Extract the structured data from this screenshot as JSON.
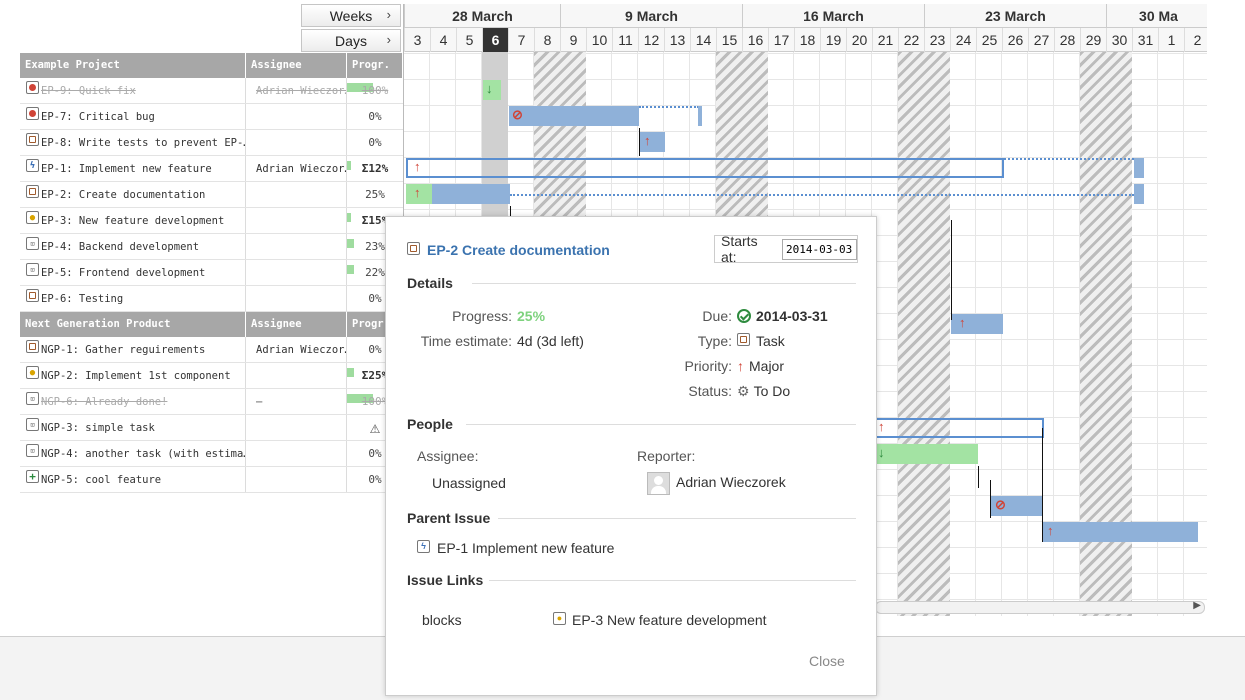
{
  "zoom": {
    "weeks_label": "Weeks",
    "days_label": "Days"
  },
  "table": {
    "groups": [
      {
        "headers": [
          "Example Project",
          "Assignee",
          "Progr."
        ],
        "rows": [
          {
            "key": "EP-9",
            "text": "EP-9: Quick fix",
            "icon": "bug-icon",
            "assignee": "Adrian Wieczor…",
            "progress": "100%",
            "done": true
          },
          {
            "key": "EP-7",
            "text": "EP-7: Critical bug",
            "icon": "bug-icon",
            "assignee": "",
            "progress": "0%"
          },
          {
            "key": "EP-8",
            "text": "EP-8: Write tests to prevent EP-…",
            "icon": "task-icon",
            "assignee": "",
            "progress": "0%"
          },
          {
            "key": "EP-1",
            "text": "EP-1: Implement new feature",
            "icon": "epic-icon",
            "assignee": "Adrian Wieczor…",
            "progress": "Σ12%"
          },
          {
            "key": "EP-2",
            "text": "EP-2: Create documentation",
            "icon": "task-icon",
            "assignee": "",
            "progress": "25%"
          },
          {
            "key": "EP-3",
            "text": "EP-3: New feature development",
            "icon": "story-icon",
            "assignee": "",
            "progress": "Σ15%"
          },
          {
            "key": "EP-4",
            "text": "EP-4: Backend development",
            "icon": "subtask-icon",
            "assignee": "",
            "progress": "23%"
          },
          {
            "key": "EP-5",
            "text": "EP-5: Frontend development",
            "icon": "subtask-icon",
            "assignee": "",
            "progress": "22%"
          },
          {
            "key": "EP-6",
            "text": "EP-6: Testing",
            "icon": "task-icon",
            "assignee": "",
            "progress": "0%"
          }
        ]
      },
      {
        "headers": [
          "Next Generation Product",
          "Assignee",
          "Progr."
        ],
        "rows": [
          {
            "key": "NGP-1",
            "text": "NGP-1: Gather reguirements",
            "icon": "task-icon",
            "assignee": "Adrian Wieczor…",
            "progress": "0%"
          },
          {
            "key": "NGP-2",
            "text": "NGP-2: Implement 1st component",
            "icon": "story-icon",
            "assignee": "",
            "progress": "Σ25%"
          },
          {
            "key": "NGP-6",
            "text": "NGP-6: Already done!",
            "icon": "subtask-icon",
            "assignee": "–",
            "progress": "100%",
            "done": true
          },
          {
            "key": "NGP-3",
            "text": "NGP-3: simple task",
            "icon": "subtask-icon",
            "assignee": "",
            "progress": "⚠"
          },
          {
            "key": "NGP-4",
            "text": "NGP-4: another task (with estima…",
            "icon": "subtask-icon",
            "assignee": "",
            "progress": "0%"
          },
          {
            "key": "NGP-5",
            "text": "NGP-5: cool feature",
            "icon": "new-feature-icon",
            "assignee": "",
            "progress": "0%"
          }
        ]
      }
    ]
  },
  "timeline": {
    "months": [
      "28 March",
      "9 March",
      "16 March",
      "23 March",
      "30 Ma"
    ],
    "days": [
      "3",
      "4",
      "5",
      "6",
      "7",
      "8",
      "9",
      "10",
      "11",
      "12",
      "13",
      "14",
      "15",
      "16",
      "17",
      "18",
      "19",
      "20",
      "21",
      "22",
      "23",
      "24",
      "25",
      "26",
      "27",
      "28",
      "29",
      "30",
      "31",
      "1",
      "2"
    ],
    "today": "6"
  },
  "popup": {
    "title": "EP-2 Create documentation",
    "starts_label": "Starts at:",
    "starts_value": "2014-03-03",
    "details_heading": "Details",
    "progress_label": "Progress:",
    "progress_value": "25%",
    "estimate_label": "Time estimate:",
    "estimate_value": "4d (3d left)",
    "due_label": "Due:",
    "due_value": "2014-03-31",
    "type_label": "Type:",
    "type_value": "Task",
    "priority_label": "Priority:",
    "priority_value": "Major",
    "status_label": "Status:",
    "status_value": "To Do",
    "people_heading": "People",
    "assignee_label": "Assignee:",
    "assignee_value": "Unassigned",
    "reporter_label": "Reporter:",
    "reporter_value": "Adrian Wieczorek",
    "parent_heading": "Parent Issue",
    "parent_value": "EP-1 Implement new feature",
    "links_heading": "Issue Links",
    "link_type": "blocks",
    "link_value": "EP-3 New feature development",
    "close_label": "Close",
    "colors": {
      "progress": "#7ed27e",
      "link": "#3b73af",
      "priority": "#d04437"
    }
  }
}
